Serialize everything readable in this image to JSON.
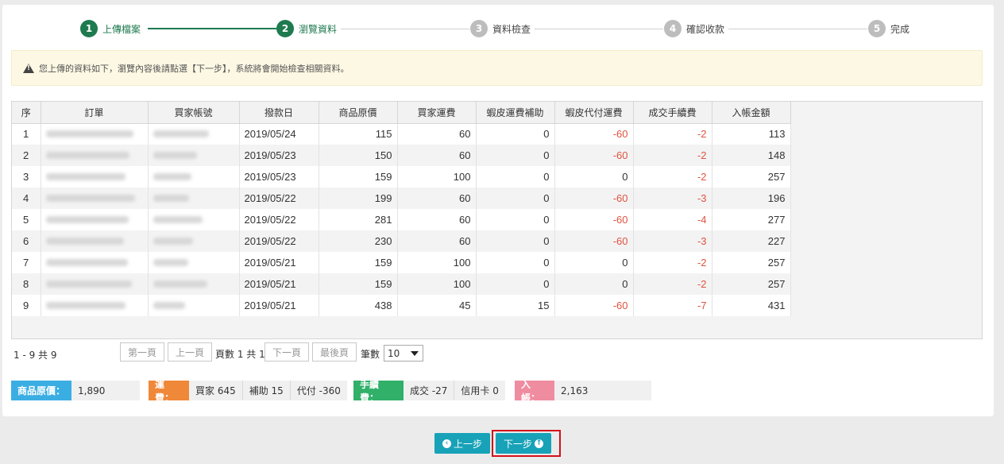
{
  "steps": [
    {
      "num": "1",
      "label": "上傳檔案",
      "state": "done"
    },
    {
      "num": "2",
      "label": "瀏覽資料",
      "state": "done"
    },
    {
      "num": "3",
      "label": "資料檢查",
      "state": "todo"
    },
    {
      "num": "4",
      "label": "確認收款",
      "state": "todo"
    },
    {
      "num": "5",
      "label": "完成",
      "state": "todo"
    }
  ],
  "notice": "您上傳的資料如下，瀏覽內容後請點選【下一步】，系統將會開始檢查相關資料。",
  "table": {
    "columns": [
      "序",
      "訂單",
      "買家帳號",
      "撥款日",
      "商品原價",
      "買家運費",
      "蝦皮運費補助",
      "蝦皮代付運費",
      "成交手續費",
      "入帳金額"
    ],
    "rows": [
      {
        "seq": "1",
        "date": "2019/05/24",
        "price": "115",
        "ship": "60",
        "subsidy": "0",
        "paid_ship": "-60",
        "fee": "-2",
        "net": "113"
      },
      {
        "seq": "2",
        "date": "2019/05/23",
        "price": "150",
        "ship": "60",
        "subsidy": "0",
        "paid_ship": "-60",
        "fee": "-2",
        "net": "148"
      },
      {
        "seq": "3",
        "date": "2019/05/23",
        "price": "159",
        "ship": "100",
        "subsidy": "0",
        "paid_ship": "0",
        "fee": "-2",
        "net": "257"
      },
      {
        "seq": "4",
        "date": "2019/05/22",
        "price": "199",
        "ship": "60",
        "subsidy": "0",
        "paid_ship": "-60",
        "fee": "-3",
        "net": "196"
      },
      {
        "seq": "5",
        "date": "2019/05/22",
        "price": "281",
        "ship": "60",
        "subsidy": "0",
        "paid_ship": "-60",
        "fee": "-4",
        "net": "277"
      },
      {
        "seq": "6",
        "date": "2019/05/22",
        "price": "230",
        "ship": "60",
        "subsidy": "0",
        "paid_ship": "-60",
        "fee": "-3",
        "net": "227"
      },
      {
        "seq": "7",
        "date": "2019/05/21",
        "price": "159",
        "ship": "100",
        "subsidy": "0",
        "paid_ship": "0",
        "fee": "-2",
        "net": "257"
      },
      {
        "seq": "8",
        "date": "2019/05/21",
        "price": "159",
        "ship": "100",
        "subsidy": "0",
        "paid_ship": "0",
        "fee": "-2",
        "net": "257"
      },
      {
        "seq": "9",
        "date": "2019/05/21",
        "price": "438",
        "ship": "45",
        "subsidy": "15",
        "paid_ship": "-60",
        "fee": "-7",
        "net": "431"
      }
    ]
  },
  "pager": {
    "summary": "1 - 9 共 9",
    "first": "第一頁",
    "prev": "上一頁",
    "page_info": "頁數 1 共 1",
    "next": "下一頁",
    "last": "最後頁",
    "per_page_label": "筆數",
    "per_page_value": "10"
  },
  "summary_bar": {
    "price_tag": "商品原價：",
    "price_val": "1,890",
    "ship_tag": "運費：",
    "ship_buyer": "買家 645",
    "ship_subsidy": "補助 15",
    "ship_paid": "代付 -360",
    "fee_tag": "手續費：",
    "fee_deal": "成交 -27",
    "fee_card": "信用卡 0",
    "net_tag": "入帳：",
    "net_val": "2,163"
  },
  "buttons": {
    "prev": "上一步",
    "next": "下一步"
  },
  "colors": {
    "step_done": "#1e7a4f",
    "negative": "#e0533f",
    "button": "#17a2b8",
    "highlight": "#d0121b"
  }
}
